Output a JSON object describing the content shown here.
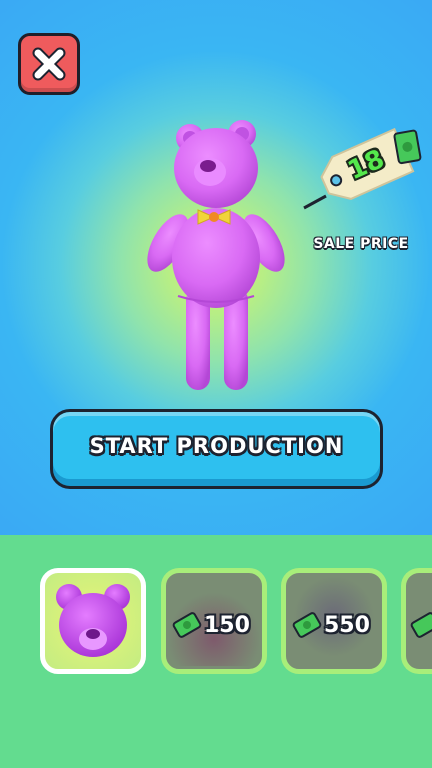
{
  "header": {
    "close_icon": "close-icon"
  },
  "product": {
    "icon": "teddy-bear",
    "body_color": "#d96af4",
    "bow_color": "#f1d43a"
  },
  "price_tag": {
    "value": "18",
    "label": "SALE PRICE",
    "icon": "cash-icon"
  },
  "start_button": {
    "label": "START PRODUCTION"
  },
  "shop": {
    "items": [
      {
        "state": "selected",
        "icon": "teddy-bear-head-icon"
      },
      {
        "state": "locked",
        "price": "150",
        "icon": "cash-icon"
      },
      {
        "state": "locked",
        "price": "550",
        "icon": "cash-icon"
      },
      {
        "state": "locked",
        "icon": "cash-icon"
      }
    ]
  },
  "colors": {
    "sky": "#3aa9f4",
    "glow": "#d8f27a",
    "button": "#2ec0ef",
    "danger": "#ef5b5d",
    "shelf": "#63dc8f",
    "cash": "#54e84c"
  }
}
